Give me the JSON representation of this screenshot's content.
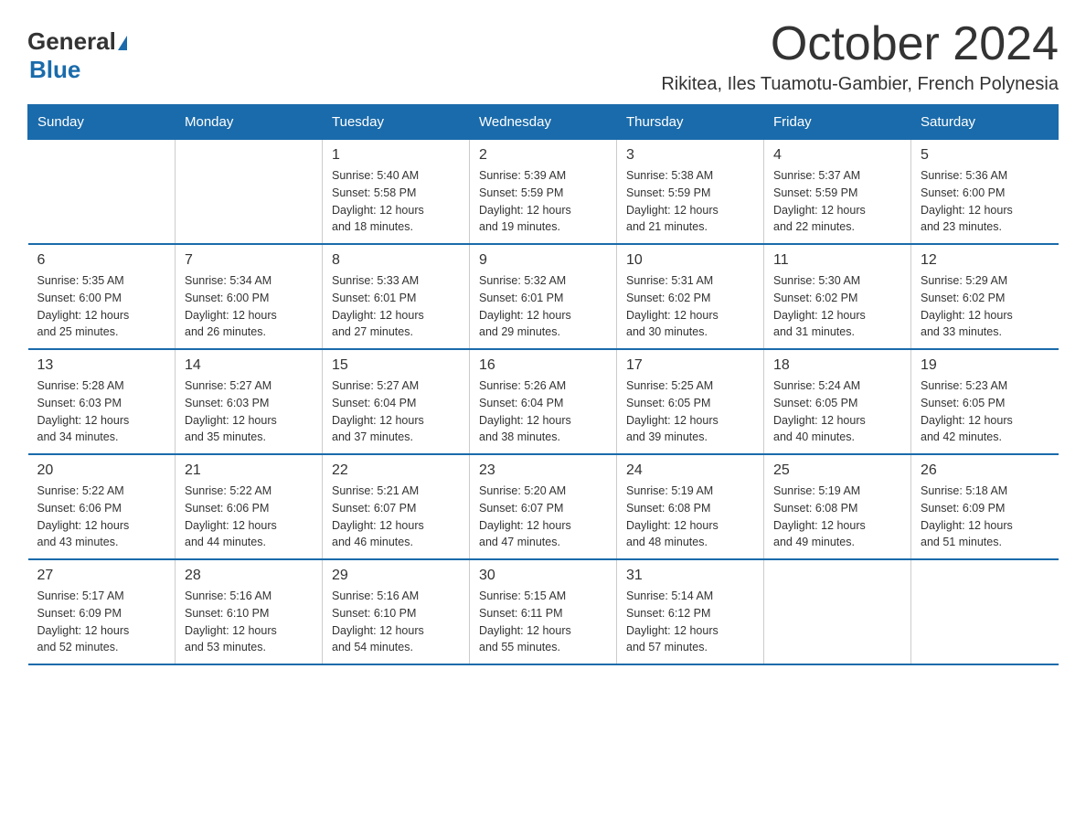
{
  "logo": {
    "general": "General",
    "blue": "Blue"
  },
  "title": "October 2024",
  "subtitle": "Rikitea, Iles Tuamotu-Gambier, French Polynesia",
  "headers": [
    "Sunday",
    "Monday",
    "Tuesday",
    "Wednesday",
    "Thursday",
    "Friday",
    "Saturday"
  ],
  "weeks": [
    [
      {
        "day": "",
        "info": ""
      },
      {
        "day": "",
        "info": ""
      },
      {
        "day": "1",
        "info": "Sunrise: 5:40 AM\nSunset: 5:58 PM\nDaylight: 12 hours\nand 18 minutes."
      },
      {
        "day": "2",
        "info": "Sunrise: 5:39 AM\nSunset: 5:59 PM\nDaylight: 12 hours\nand 19 minutes."
      },
      {
        "day": "3",
        "info": "Sunrise: 5:38 AM\nSunset: 5:59 PM\nDaylight: 12 hours\nand 21 minutes."
      },
      {
        "day": "4",
        "info": "Sunrise: 5:37 AM\nSunset: 5:59 PM\nDaylight: 12 hours\nand 22 minutes."
      },
      {
        "day": "5",
        "info": "Sunrise: 5:36 AM\nSunset: 6:00 PM\nDaylight: 12 hours\nand 23 minutes."
      }
    ],
    [
      {
        "day": "6",
        "info": "Sunrise: 5:35 AM\nSunset: 6:00 PM\nDaylight: 12 hours\nand 25 minutes."
      },
      {
        "day": "7",
        "info": "Sunrise: 5:34 AM\nSunset: 6:00 PM\nDaylight: 12 hours\nand 26 minutes."
      },
      {
        "day": "8",
        "info": "Sunrise: 5:33 AM\nSunset: 6:01 PM\nDaylight: 12 hours\nand 27 minutes."
      },
      {
        "day": "9",
        "info": "Sunrise: 5:32 AM\nSunset: 6:01 PM\nDaylight: 12 hours\nand 29 minutes."
      },
      {
        "day": "10",
        "info": "Sunrise: 5:31 AM\nSunset: 6:02 PM\nDaylight: 12 hours\nand 30 minutes."
      },
      {
        "day": "11",
        "info": "Sunrise: 5:30 AM\nSunset: 6:02 PM\nDaylight: 12 hours\nand 31 minutes."
      },
      {
        "day": "12",
        "info": "Sunrise: 5:29 AM\nSunset: 6:02 PM\nDaylight: 12 hours\nand 33 minutes."
      }
    ],
    [
      {
        "day": "13",
        "info": "Sunrise: 5:28 AM\nSunset: 6:03 PM\nDaylight: 12 hours\nand 34 minutes."
      },
      {
        "day": "14",
        "info": "Sunrise: 5:27 AM\nSunset: 6:03 PM\nDaylight: 12 hours\nand 35 minutes."
      },
      {
        "day": "15",
        "info": "Sunrise: 5:27 AM\nSunset: 6:04 PM\nDaylight: 12 hours\nand 37 minutes."
      },
      {
        "day": "16",
        "info": "Sunrise: 5:26 AM\nSunset: 6:04 PM\nDaylight: 12 hours\nand 38 minutes."
      },
      {
        "day": "17",
        "info": "Sunrise: 5:25 AM\nSunset: 6:05 PM\nDaylight: 12 hours\nand 39 minutes."
      },
      {
        "day": "18",
        "info": "Sunrise: 5:24 AM\nSunset: 6:05 PM\nDaylight: 12 hours\nand 40 minutes."
      },
      {
        "day": "19",
        "info": "Sunrise: 5:23 AM\nSunset: 6:05 PM\nDaylight: 12 hours\nand 42 minutes."
      }
    ],
    [
      {
        "day": "20",
        "info": "Sunrise: 5:22 AM\nSunset: 6:06 PM\nDaylight: 12 hours\nand 43 minutes."
      },
      {
        "day": "21",
        "info": "Sunrise: 5:22 AM\nSunset: 6:06 PM\nDaylight: 12 hours\nand 44 minutes."
      },
      {
        "day": "22",
        "info": "Sunrise: 5:21 AM\nSunset: 6:07 PM\nDaylight: 12 hours\nand 46 minutes."
      },
      {
        "day": "23",
        "info": "Sunrise: 5:20 AM\nSunset: 6:07 PM\nDaylight: 12 hours\nand 47 minutes."
      },
      {
        "day": "24",
        "info": "Sunrise: 5:19 AM\nSunset: 6:08 PM\nDaylight: 12 hours\nand 48 minutes."
      },
      {
        "day": "25",
        "info": "Sunrise: 5:19 AM\nSunset: 6:08 PM\nDaylight: 12 hours\nand 49 minutes."
      },
      {
        "day": "26",
        "info": "Sunrise: 5:18 AM\nSunset: 6:09 PM\nDaylight: 12 hours\nand 51 minutes."
      }
    ],
    [
      {
        "day": "27",
        "info": "Sunrise: 5:17 AM\nSunset: 6:09 PM\nDaylight: 12 hours\nand 52 minutes."
      },
      {
        "day": "28",
        "info": "Sunrise: 5:16 AM\nSunset: 6:10 PM\nDaylight: 12 hours\nand 53 minutes."
      },
      {
        "day": "29",
        "info": "Sunrise: 5:16 AM\nSunset: 6:10 PM\nDaylight: 12 hours\nand 54 minutes."
      },
      {
        "day": "30",
        "info": "Sunrise: 5:15 AM\nSunset: 6:11 PM\nDaylight: 12 hours\nand 55 minutes."
      },
      {
        "day": "31",
        "info": "Sunrise: 5:14 AM\nSunset: 6:12 PM\nDaylight: 12 hours\nand 57 minutes."
      },
      {
        "day": "",
        "info": ""
      },
      {
        "day": "",
        "info": ""
      }
    ]
  ]
}
